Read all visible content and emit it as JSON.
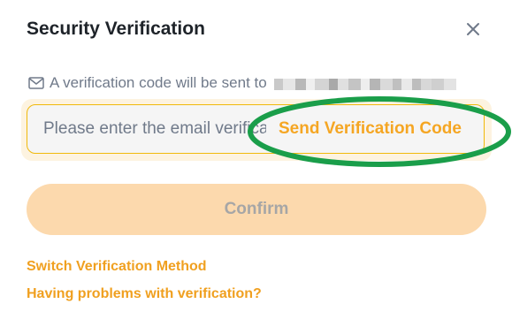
{
  "dialog": {
    "title": "Security Verification",
    "close_icon": "close-icon"
  },
  "info": {
    "icon": "mail-icon",
    "text": "A verification code will be sent to"
  },
  "code_field": {
    "placeholder": "Please enter the email verification code",
    "value": "",
    "send_label": "Send Verification Code"
  },
  "confirm": {
    "label": "Confirm"
  },
  "links": {
    "switch_method": "Switch Verification Method",
    "problems": "Having problems with verification?"
  },
  "colors": {
    "accent": "#f5a623",
    "highlight_ellipse": "#1a9e4a",
    "confirm_bg": "#fcd9ad",
    "title": "#1e2329"
  }
}
